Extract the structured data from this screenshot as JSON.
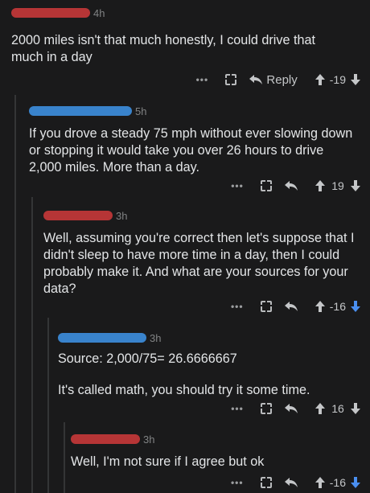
{
  "comments": [
    {
      "time": "4h",
      "text": "2000 miles isn't that much honestly, I could drive that much in a day",
      "reply_label": "Reply",
      "score": "-19",
      "downvoted": false
    },
    {
      "time": "5h",
      "text": "If you drove a steady 75 mph without ever slowing down or stopping it would take you over 26 hours to drive 2,000 miles. More than a day.",
      "score": "19",
      "downvoted": false
    },
    {
      "time": "3h",
      "text": "Well, assuming you're correct then let's suppose that I didn't sleep to have more time in a day, then I could probably make it. And what are your sources for your data?",
      "score": "-16",
      "downvoted": true
    },
    {
      "time": "3h",
      "text": "Source: 2,000/75= 26.6666667",
      "text2": "It's called math, you should try it some time.",
      "score": "16",
      "downvoted": false
    },
    {
      "time": "3h",
      "text": "Well, I'm not sure if I agree but ok",
      "score": "-16",
      "downvoted": true
    }
  ],
  "icons": {
    "more": "more-icon",
    "award": "gift-icon",
    "reply": "reply-arrow-icon",
    "upvote": "upvote-icon",
    "downvote": "downvote-icon"
  },
  "colors": {
    "background": "#1a1a1b",
    "downvote_active": "#4a8ff0",
    "redact_red": "#d23b3b",
    "redact_blue": "#3d8fe0"
  }
}
